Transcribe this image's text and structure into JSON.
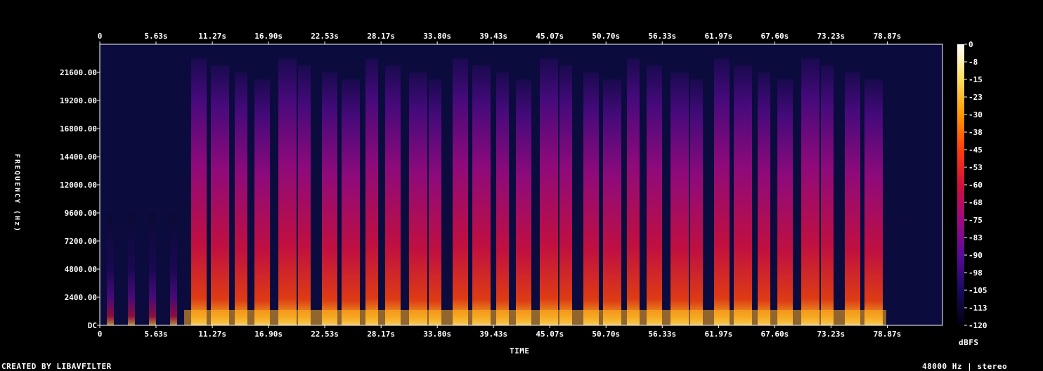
{
  "chart_data": {
    "type": "heatmap",
    "subtype": "spectrogram",
    "xlabel": "TIME",
    "ylabel": "FREQUENCY (Hz)",
    "x_ticks": [
      "0",
      "5.63s",
      "11.27s",
      "16.90s",
      "22.53s",
      "28.17s",
      "33.80s",
      "39.43s",
      "45.07s",
      "50.70s",
      "56.33s",
      "61.97s",
      "67.60s",
      "73.23s",
      "78.87s"
    ],
    "x_tick_values": [
      0,
      5.63,
      11.27,
      16.9,
      22.53,
      28.17,
      33.8,
      39.43,
      45.07,
      50.7,
      56.33,
      61.97,
      67.6,
      73.23,
      78.87
    ],
    "xlim": [
      0,
      84.4
    ],
    "y_ticks": [
      "DC",
      "2400.00",
      "4800.00",
      "7200.00",
      "9600.00",
      "12000.00",
      "14400.00",
      "16800.00",
      "19200.00",
      "21600.00"
    ],
    "y_tick_values": [
      0,
      2400,
      4800,
      7200,
      9600,
      12000,
      14400,
      16800,
      19200,
      21600
    ],
    "ylim": [
      0,
      24000
    ],
    "colorbar": {
      "unit": "dBFS",
      "ticks": [
        "0",
        "-8",
        "-15",
        "-23",
        "-30",
        "-38",
        "-45",
        "-53",
        "-60",
        "-68",
        "-75",
        "-83",
        "-90",
        "-98",
        "-105",
        "-113",
        "-120"
      ],
      "range": [
        -120,
        0
      ]
    },
    "colormap": [
      "#000000",
      "#0a0a3c",
      "#2a0a6e",
      "#6a0aa0",
      "#a00a8a",
      "#d2103c",
      "#f03c0a",
      "#ff9a0a",
      "#ffe040",
      "#ffffd0"
    ],
    "footer_left": "CREATED BY LIBAVFILTER",
    "footer_right": "48000 Hz | stereo"
  }
}
